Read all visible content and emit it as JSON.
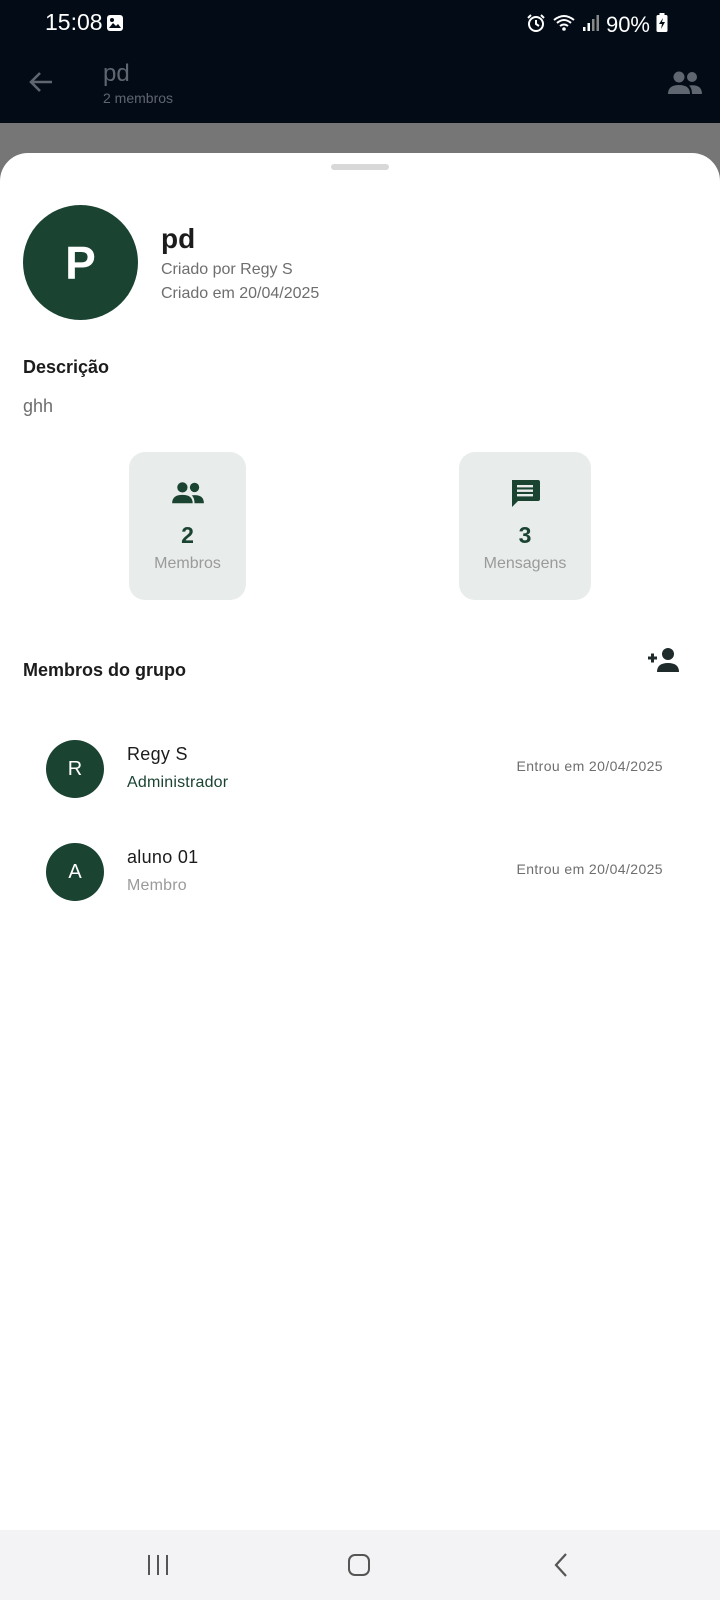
{
  "status_bar": {
    "time": "15:08",
    "battery": "90%",
    "icons": [
      "gallery-icon",
      "alarm-icon",
      "wifi-icon",
      "signal-icon",
      "battery-charging-icon"
    ]
  },
  "app_bar": {
    "title": "pd",
    "subtitle": "2 membros",
    "icons": [
      "back-arrow-icon",
      "group-icon"
    ]
  },
  "group": {
    "avatar_letter": "P",
    "name": "pd",
    "created_by": "Criado por Regy S",
    "created_at": "Criado em 20/04/2025"
  },
  "description": {
    "heading": "Descrição",
    "text": "ghh"
  },
  "stats": {
    "members": {
      "value": "2",
      "label": "Membros",
      "icon": "group-icon"
    },
    "messages": {
      "value": "3",
      "label": "Mensagens",
      "icon": "chat-icon"
    }
  },
  "members_section": {
    "heading": "Membros do grupo",
    "add_icon": "person-add-icon",
    "members": [
      {
        "initial": "R",
        "name": "Regy S",
        "role": "Administrador",
        "joined": "Entrou em 20/04/2025"
      },
      {
        "initial": "A",
        "name": "aluno 01",
        "role": "Membro",
        "joined": "Entrou em 20/04/2025"
      }
    ]
  },
  "colors": {
    "accent": "#1b4332",
    "status_bar_bg": "#020b16",
    "stat_card_bg": "#e8eceb"
  }
}
